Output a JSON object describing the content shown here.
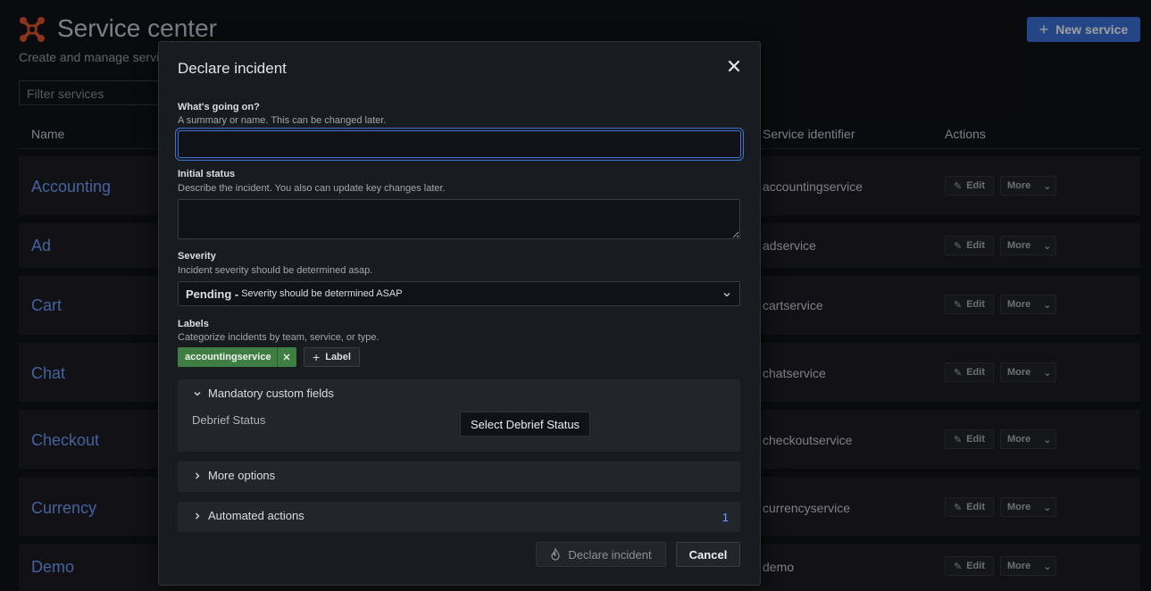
{
  "page": {
    "title": "Service center",
    "subtitle": "Create and manage servic",
    "new_service_label": "New service",
    "filter_placeholder": "Filter services",
    "columns": {
      "name": "Name",
      "service_identifier": "Service identifier",
      "actions": "Actions"
    },
    "rows": [
      {
        "name": "Accounting",
        "identifier": "accountingservice"
      },
      {
        "name": "Ad",
        "identifier": "adservice"
      },
      {
        "name": "Cart",
        "identifier": "cartservice"
      },
      {
        "name": "Chat",
        "identifier": "chatservice"
      },
      {
        "name": "Checkout",
        "identifier": "checkoutservice"
      },
      {
        "name": "Currency",
        "identifier": "currencyservice"
      },
      {
        "name": "Demo",
        "identifier": "demo"
      }
    ],
    "edit_label": "Edit",
    "more_label": "More"
  },
  "modal": {
    "title": "Declare incident",
    "summary": {
      "label": "What's going on?",
      "description": "A summary or name. This can be changed later.",
      "value": ""
    },
    "initial_status": {
      "label": "Initial status",
      "description": "Describe the incident. You also can update key changes later.",
      "value": ""
    },
    "severity": {
      "label": "Severity",
      "description": "Incident severity should be determined asap.",
      "selected_main": "Pending -",
      "selected_detail": "Severity should be determined ASAP"
    },
    "labels": {
      "label": "Labels",
      "description": "Categorize incidents by team, service, or type.",
      "chips": [
        "accountingservice"
      ],
      "add_label": "Label"
    },
    "mandatory_fields": {
      "title": "Mandatory custom fields",
      "field_label": "Debrief Status",
      "field_button": "Select Debrief Status"
    },
    "more_options": {
      "title": "More options"
    },
    "automated_actions": {
      "title": "Automated actions",
      "count": "1"
    },
    "declare_label": "Declare incident",
    "cancel_label": "Cancel"
  },
  "colors": {
    "accent": "#3d71d9",
    "link": "#6e9fff",
    "chip": "#3f7e43",
    "logo": "#e0542c"
  }
}
